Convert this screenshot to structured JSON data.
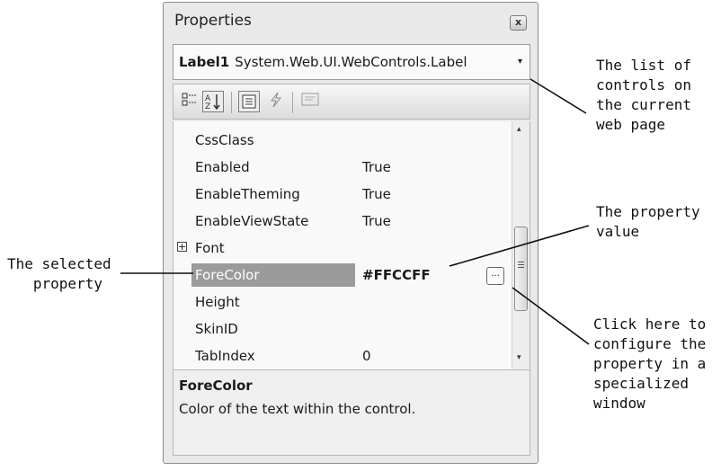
{
  "window": {
    "title": "Properties",
    "close_glyph": "x"
  },
  "control_selector": {
    "name": "Label1",
    "type": "System.Web.UI.WebControls.Label",
    "dropdown_glyph": "▾"
  },
  "toolbar": {
    "categorized_icon": "categorized-icon",
    "alphabetical_icon": "alphabetical-icon",
    "properties_icon": "properties-icon",
    "events_icon": "events-icon",
    "property_pages_icon": "property-pages-icon"
  },
  "properties": [
    {
      "name": "CssClass",
      "value": ""
    },
    {
      "name": "Enabled",
      "value": "True"
    },
    {
      "name": "EnableTheming",
      "value": "True"
    },
    {
      "name": "EnableViewState",
      "value": "True"
    },
    {
      "name": "Font",
      "value": "",
      "expander": "+"
    },
    {
      "name": "ForeColor",
      "value": "#FFCCFF",
      "selected": true,
      "ellipsis": "..."
    },
    {
      "name": "Height",
      "value": ""
    },
    {
      "name": "SkinID",
      "value": ""
    },
    {
      "name": "TabIndex",
      "value": "0"
    }
  ],
  "scrollbar": {
    "up": "▴",
    "down": "▾"
  },
  "description": {
    "title": "ForeColor",
    "text": "Color of the text within the control."
  },
  "annotations": {
    "control_list": "The list of\ncontrols on\nthe current\nweb page",
    "property_value": "The property\nvalue",
    "selected_property": "The selected\n   property",
    "ellipsis_hint": "Click here to\nconfigure the\nproperty in a\nspecialized\nwindow"
  },
  "colors": {
    "selected_bg": "#9b9b9b",
    "panel_bg": "#e9e9e9"
  }
}
